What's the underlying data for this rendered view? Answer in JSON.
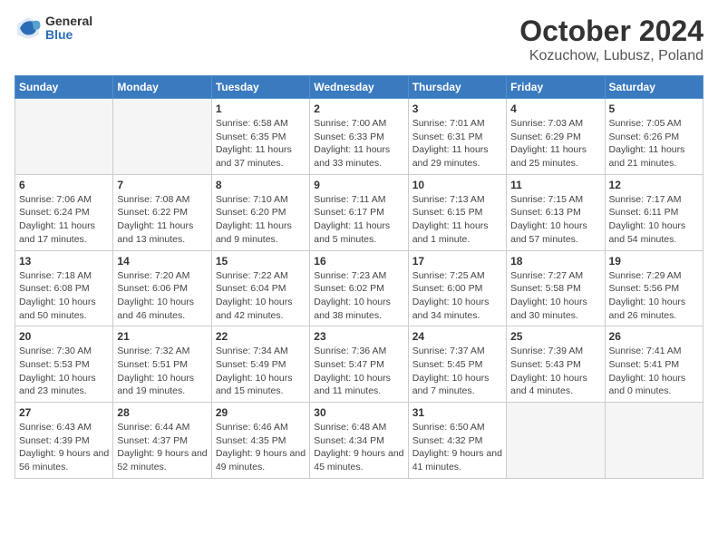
{
  "header": {
    "logo_general": "General",
    "logo_blue": "Blue",
    "title": "October 2024",
    "subtitle": "Kozuchow, Lubusz, Poland"
  },
  "days_of_week": [
    "Sunday",
    "Monday",
    "Tuesday",
    "Wednesday",
    "Thursday",
    "Friday",
    "Saturday"
  ],
  "weeks": [
    [
      {
        "day": "",
        "detail": ""
      },
      {
        "day": "",
        "detail": ""
      },
      {
        "day": "1",
        "detail": "Sunrise: 6:58 AM\nSunset: 6:35 PM\nDaylight: 11 hours and 37 minutes."
      },
      {
        "day": "2",
        "detail": "Sunrise: 7:00 AM\nSunset: 6:33 PM\nDaylight: 11 hours and 33 minutes."
      },
      {
        "day": "3",
        "detail": "Sunrise: 7:01 AM\nSunset: 6:31 PM\nDaylight: 11 hours and 29 minutes."
      },
      {
        "day": "4",
        "detail": "Sunrise: 7:03 AM\nSunset: 6:29 PM\nDaylight: 11 hours and 25 minutes."
      },
      {
        "day": "5",
        "detail": "Sunrise: 7:05 AM\nSunset: 6:26 PM\nDaylight: 11 hours and 21 minutes."
      }
    ],
    [
      {
        "day": "6",
        "detail": "Sunrise: 7:06 AM\nSunset: 6:24 PM\nDaylight: 11 hours and 17 minutes."
      },
      {
        "day": "7",
        "detail": "Sunrise: 7:08 AM\nSunset: 6:22 PM\nDaylight: 11 hours and 13 minutes."
      },
      {
        "day": "8",
        "detail": "Sunrise: 7:10 AM\nSunset: 6:20 PM\nDaylight: 11 hours and 9 minutes."
      },
      {
        "day": "9",
        "detail": "Sunrise: 7:11 AM\nSunset: 6:17 PM\nDaylight: 11 hours and 5 minutes."
      },
      {
        "day": "10",
        "detail": "Sunrise: 7:13 AM\nSunset: 6:15 PM\nDaylight: 11 hours and 1 minute."
      },
      {
        "day": "11",
        "detail": "Sunrise: 7:15 AM\nSunset: 6:13 PM\nDaylight: 10 hours and 57 minutes."
      },
      {
        "day": "12",
        "detail": "Sunrise: 7:17 AM\nSunset: 6:11 PM\nDaylight: 10 hours and 54 minutes."
      }
    ],
    [
      {
        "day": "13",
        "detail": "Sunrise: 7:18 AM\nSunset: 6:08 PM\nDaylight: 10 hours and 50 minutes."
      },
      {
        "day": "14",
        "detail": "Sunrise: 7:20 AM\nSunset: 6:06 PM\nDaylight: 10 hours and 46 minutes."
      },
      {
        "day": "15",
        "detail": "Sunrise: 7:22 AM\nSunset: 6:04 PM\nDaylight: 10 hours and 42 minutes."
      },
      {
        "day": "16",
        "detail": "Sunrise: 7:23 AM\nSunset: 6:02 PM\nDaylight: 10 hours and 38 minutes."
      },
      {
        "day": "17",
        "detail": "Sunrise: 7:25 AM\nSunset: 6:00 PM\nDaylight: 10 hours and 34 minutes."
      },
      {
        "day": "18",
        "detail": "Sunrise: 7:27 AM\nSunset: 5:58 PM\nDaylight: 10 hours and 30 minutes."
      },
      {
        "day": "19",
        "detail": "Sunrise: 7:29 AM\nSunset: 5:56 PM\nDaylight: 10 hours and 26 minutes."
      }
    ],
    [
      {
        "day": "20",
        "detail": "Sunrise: 7:30 AM\nSunset: 5:53 PM\nDaylight: 10 hours and 23 minutes."
      },
      {
        "day": "21",
        "detail": "Sunrise: 7:32 AM\nSunset: 5:51 PM\nDaylight: 10 hours and 19 minutes."
      },
      {
        "day": "22",
        "detail": "Sunrise: 7:34 AM\nSunset: 5:49 PM\nDaylight: 10 hours and 15 minutes."
      },
      {
        "day": "23",
        "detail": "Sunrise: 7:36 AM\nSunset: 5:47 PM\nDaylight: 10 hours and 11 minutes."
      },
      {
        "day": "24",
        "detail": "Sunrise: 7:37 AM\nSunset: 5:45 PM\nDaylight: 10 hours and 7 minutes."
      },
      {
        "day": "25",
        "detail": "Sunrise: 7:39 AM\nSunset: 5:43 PM\nDaylight: 10 hours and 4 minutes."
      },
      {
        "day": "26",
        "detail": "Sunrise: 7:41 AM\nSunset: 5:41 PM\nDaylight: 10 hours and 0 minutes."
      }
    ],
    [
      {
        "day": "27",
        "detail": "Sunrise: 6:43 AM\nSunset: 4:39 PM\nDaylight: 9 hours and 56 minutes."
      },
      {
        "day": "28",
        "detail": "Sunrise: 6:44 AM\nSunset: 4:37 PM\nDaylight: 9 hours and 52 minutes."
      },
      {
        "day": "29",
        "detail": "Sunrise: 6:46 AM\nSunset: 4:35 PM\nDaylight: 9 hours and 49 minutes."
      },
      {
        "day": "30",
        "detail": "Sunrise: 6:48 AM\nSunset: 4:34 PM\nDaylight: 9 hours and 45 minutes."
      },
      {
        "day": "31",
        "detail": "Sunrise: 6:50 AM\nSunset: 4:32 PM\nDaylight: 9 hours and 41 minutes."
      },
      {
        "day": "",
        "detail": ""
      },
      {
        "day": "",
        "detail": ""
      }
    ]
  ]
}
